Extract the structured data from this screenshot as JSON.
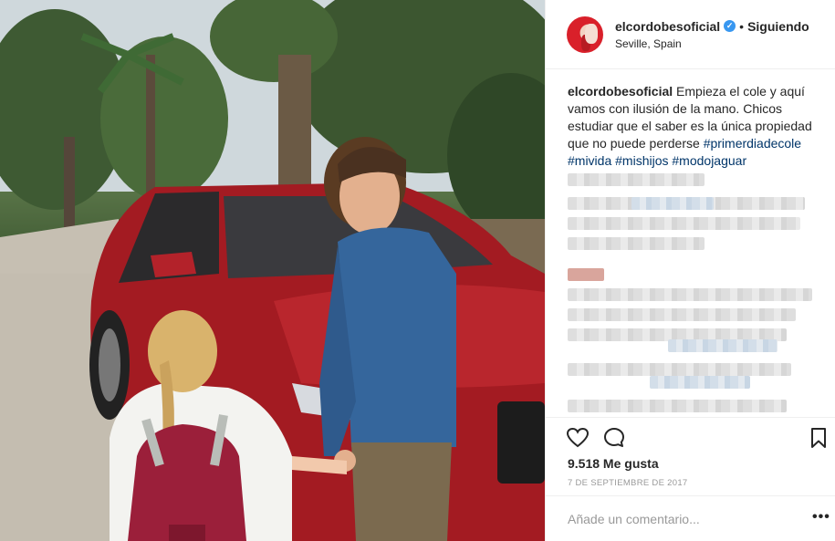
{
  "header": {
    "username": "elcordobesoficial",
    "verified_glyph": "✓",
    "separator": "•",
    "follow_label": "Siguiendo",
    "location": "Seville, Spain"
  },
  "caption": {
    "username": "elcordobesoficial",
    "text": " Empieza el cole y aquí vamos con ilusión de la mano. Chicos estudiar que el saber es la única propiedad que no puede perderse ",
    "hashtags": [
      "#primerdiadecole",
      "#mivida",
      "#mishijos",
      "#modojaguar"
    ]
  },
  "stats": {
    "likes": "9.518 Me gusta",
    "date": "7 DE SEPTIEMBRE DE 2017"
  },
  "comment": {
    "placeholder": "Añade un comentario...",
    "more_label": "•••"
  },
  "icons": {
    "like": "heart-icon",
    "comment": "comment-bubble-icon",
    "save": "bookmark-icon",
    "verified": "verified-badge-icon"
  },
  "colors": {
    "link": "#003569",
    "verified": "#3897f0",
    "muted": "#999999",
    "text": "#262626",
    "car": "#a31b22"
  }
}
